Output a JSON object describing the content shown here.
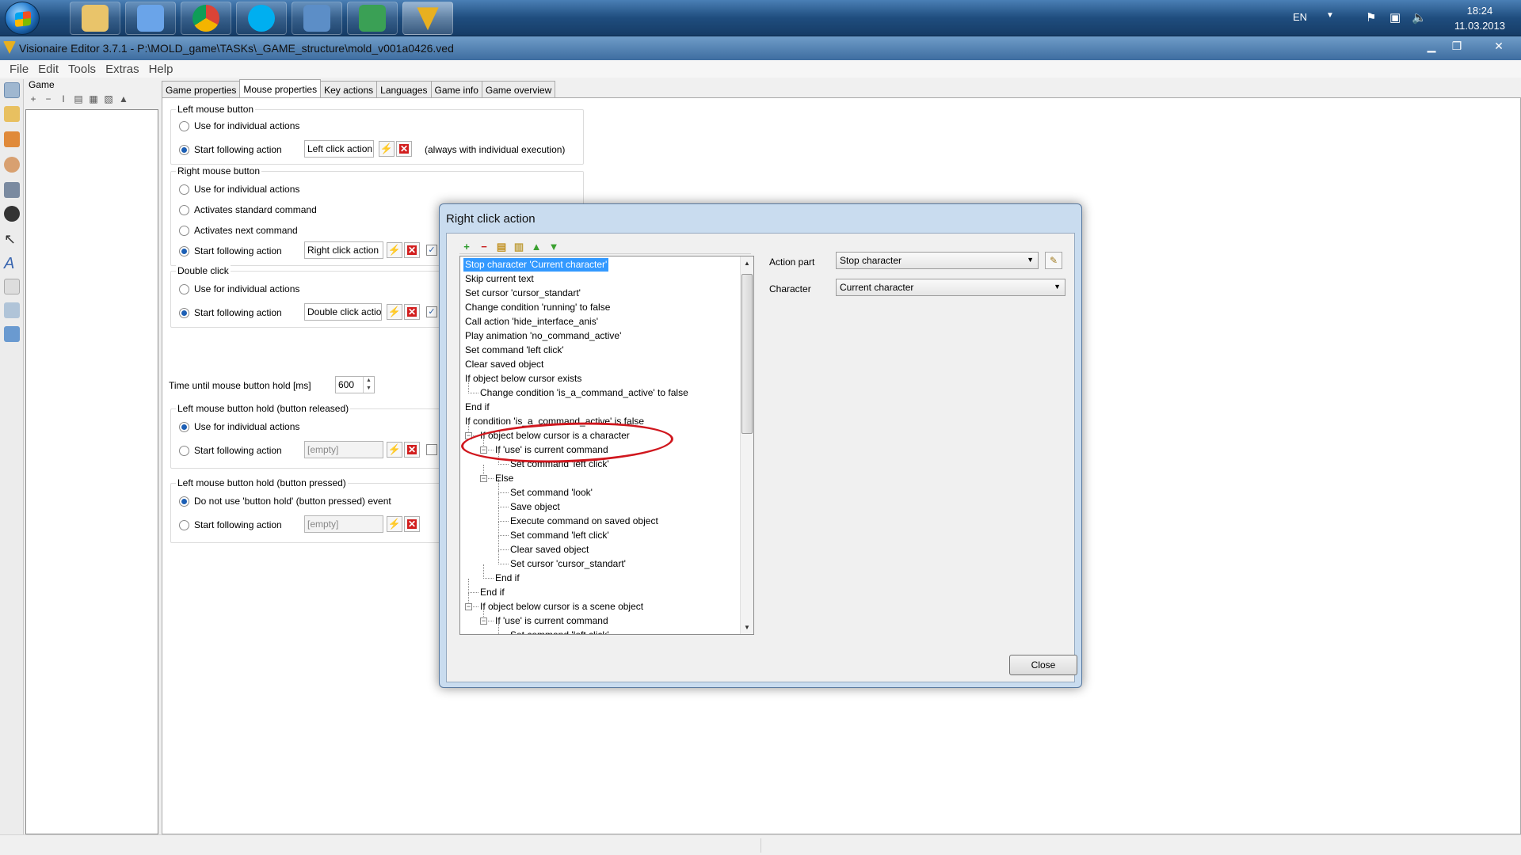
{
  "taskbar": {
    "apps": [
      {
        "name": "explorer",
        "color": "#e9c46a"
      },
      {
        "name": "network",
        "color": "#6aa4e9"
      },
      {
        "name": "chrome",
        "color": "#db4437"
      },
      {
        "name": "skype",
        "color": "#00aff0"
      },
      {
        "name": "thunderbird",
        "color": "#5c8ec7"
      },
      {
        "name": "calendar",
        "color": "#3aa055"
      },
      {
        "name": "visionaire",
        "color": "#e8b020"
      }
    ],
    "language": "EN",
    "time": "18:24",
    "date": "11.03.2013"
  },
  "window": {
    "title": "Visionaire Editor 3.7.1 - P:\\MOLD_game\\TASKs\\_GAME_structure\\mold_v001a0426.ved",
    "minimize": "▁",
    "maximize": "❐",
    "close": "✕"
  },
  "menu": [
    "File",
    "Edit",
    "Tools",
    "Extras",
    "Help"
  ],
  "tree": {
    "header": "Game"
  },
  "tabs": [
    "Game properties",
    "Mouse properties",
    "Key actions",
    "Languages",
    "Game info",
    "Game overview"
  ],
  "mouse": {
    "left": {
      "title": "Left mouse button",
      "opt1": "Use for individual actions",
      "opt2": "Start following action",
      "action": "Left click action",
      "note": "(always with individual execution)"
    },
    "right": {
      "title": "Right mouse button",
      "opt1": "Use for individual actions",
      "opt2": "Activates standard command",
      "opt3": "Activates next command",
      "opt4": "Start following action",
      "action": "Right click action"
    },
    "double": {
      "title": "Double click",
      "opt1": "Use for individual actions",
      "opt2": "Start following action",
      "action": "Double click action"
    },
    "hold_time": {
      "label": "Time until mouse button hold [ms]",
      "value": "600"
    },
    "hold_released": {
      "title": "Left mouse button hold (button released)",
      "opt1": "Use for individual actions",
      "opt2": "Start following action",
      "action": "[empty]"
    },
    "hold_pressed": {
      "title": "Left mouse button hold (button pressed)",
      "opt1": "Do not use 'button hold' (button pressed) event",
      "opt2": "Start following action",
      "action": "[empty]"
    }
  },
  "dialog": {
    "title": "Right click action",
    "actions": [
      "Stop character 'Current character'",
      "Skip current text",
      "Set cursor 'cursor_standart'",
      "Change condition 'running' to false",
      "Call action 'hide_interface_anis'",
      "Play animation 'no_command_active'",
      "Set command 'left click'",
      "Clear saved object",
      "If object below cursor exists",
      "Change condition 'is_a_command_active' to false",
      "End if",
      "If condition 'is_a_command_active' is false",
      "If object below cursor is a character",
      "If 'use' is current command",
      "Set command 'left click'",
      "Else",
      "Set command 'look'",
      "Save object",
      "Execute command on saved object",
      "Set command 'left click'",
      "Clear saved object",
      "Set cursor 'cursor_standart'",
      "End if",
      "End if",
      "If object below cursor is a scene object",
      "If 'use' is current command",
      "Set command 'left click'"
    ],
    "action_part_label": "Action part",
    "action_part_value": "Stop character",
    "character_label": "Character",
    "character_value": "Current character",
    "close_label": "Close"
  }
}
